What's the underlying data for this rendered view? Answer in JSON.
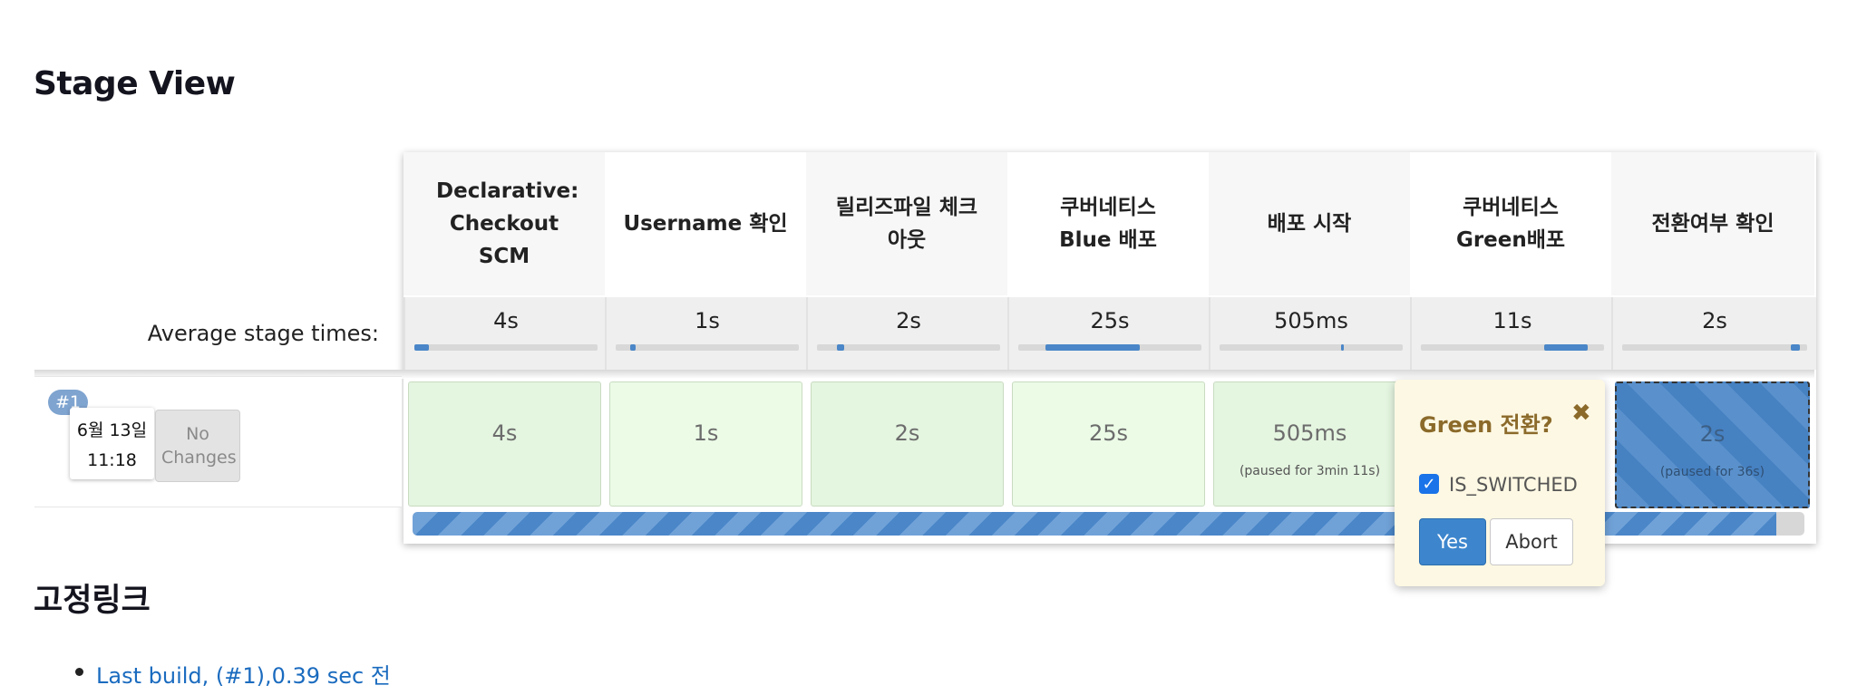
{
  "page": {
    "title": "Stage View"
  },
  "stages": [
    {
      "name": "Declarative: Checkout SCM",
      "avg": "4s",
      "value": "4s",
      "note": ""
    },
    {
      "name": "Username 확인",
      "avg": "1s",
      "value": "1s",
      "note": ""
    },
    {
      "name": "릴리즈파일 체크아웃",
      "avg": "2s",
      "value": "2s",
      "note": ""
    },
    {
      "name": "쿠버네티스 Blue 배포",
      "avg": "25s",
      "value": "25s",
      "note": ""
    },
    {
      "name": "배포 시작",
      "avg": "505ms",
      "value": "505ms",
      "note": "(paused for 3min 11s)"
    },
    {
      "name": "쿠버네티스 Green배포",
      "avg": "11s",
      "value": "",
      "note": ""
    },
    {
      "name": "전환여부 확인",
      "avg": "2s",
      "value": "2s",
      "note": "(paused for 36s)"
    }
  ],
  "avg_label": "Average stage times:",
  "build": {
    "badge": "#1",
    "date": "6월 13일",
    "time": "11:18",
    "changes": "No Changes"
  },
  "popup": {
    "title": "Green 전환?",
    "close": "✖",
    "param": "IS_SWITCHED",
    "checked": true,
    "yes": "Yes",
    "abort": "Abort"
  },
  "progress": {
    "percent": 98
  },
  "links": {
    "title": "고정링크",
    "items": [
      "Last build, (#1),0.39 sec 전"
    ]
  },
  "colors": {
    "accent": "#4a86c8",
    "success": "#e4f5e0",
    "popup": "#fdf8e3"
  }
}
